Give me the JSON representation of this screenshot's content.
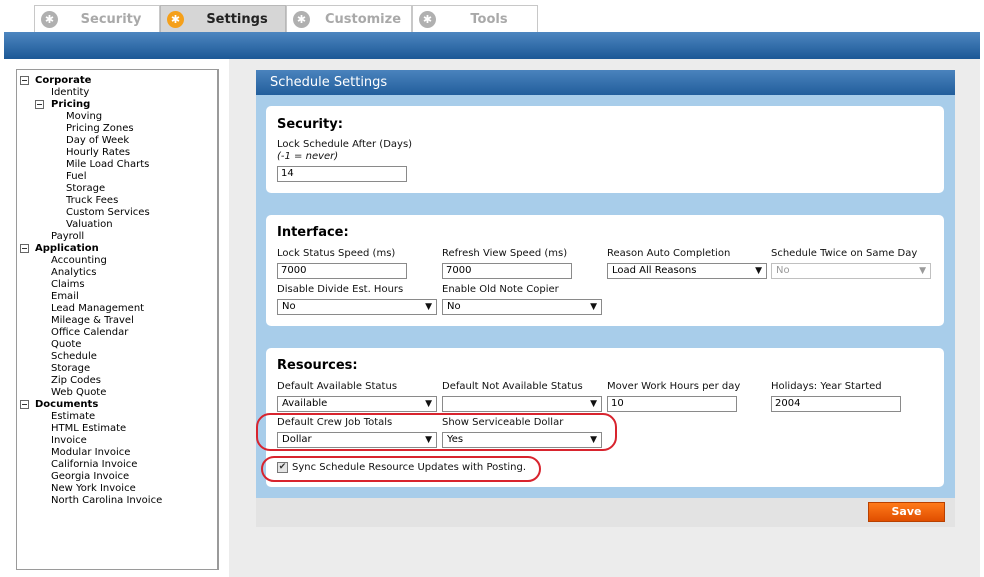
{
  "tabs": [
    {
      "label": "Security",
      "icon": "asterisk-icon"
    },
    {
      "label": "Settings",
      "icon": "asterisk-icon",
      "active": true
    },
    {
      "label": "Customize",
      "icon": "asterisk-icon"
    },
    {
      "label": "Tools",
      "icon": "asterisk-icon"
    }
  ],
  "tree": {
    "corporate": "Corporate",
    "identity": "Identity",
    "pricing": "Pricing",
    "pricing_items": [
      "Moving",
      "Pricing Zones",
      "Day of Week",
      "Hourly Rates",
      "Mile Load Charts",
      "Fuel",
      "Storage",
      "Truck Fees",
      "Custom Services",
      "Valuation"
    ],
    "payroll": "Payroll",
    "application": "Application",
    "application_items": [
      "Accounting",
      "Analytics",
      "Claims",
      "Email",
      "Lead Management",
      "Mileage & Travel",
      "Office Calendar",
      "Quote",
      "Schedule",
      "Storage",
      "Zip Codes",
      "Web Quote"
    ],
    "documents": "Documents",
    "documents_items": [
      "Estimate",
      "HTML Estimate",
      "Invoice",
      "Modular Invoice",
      "California Invoice",
      "Georgia Invoice",
      "New York Invoice",
      "North Carolina Invoice"
    ]
  },
  "schedule": {
    "title": "Schedule Settings",
    "security": {
      "heading": "Security:",
      "lock_label": "Lock Schedule After (Days)",
      "lock_hint": "(-1 = never)",
      "lock_value": "14"
    },
    "interface": {
      "heading": "Interface:",
      "lock_status_label": "Lock Status Speed (ms)",
      "lock_status_value": "7000",
      "refresh_label": "Refresh View Speed (ms)",
      "refresh_value": "7000",
      "reason_label": "Reason Auto Completion",
      "reason_value": "Load All Reasons",
      "twice_label": "Schedule Twice on Same Day",
      "twice_value": "No",
      "divide_label": "Disable Divide Est. Hours",
      "divide_value": "No",
      "copier_label": "Enable Old Note Copier",
      "copier_value": "No"
    },
    "resources": {
      "heading": "Resources:",
      "avail_label": "Default Available Status",
      "avail_value": "Available",
      "not_avail_label": "Default Not Available Status",
      "not_avail_value": "",
      "mover_label": "Mover Work Hours per day",
      "mover_value": "10",
      "holidays_label": "Holidays: Year Started",
      "holidays_value": "2004",
      "crew_label": "Default Crew Job Totals",
      "crew_value": "Dollar",
      "serviceable_label": "Show Serviceable Dollar",
      "serviceable_value": "Yes",
      "sync_label": "Sync Schedule Resource Updates with Posting.",
      "sync_checked": true
    },
    "save_label": "Save"
  },
  "colors": {
    "accent_blue": "#1c5896",
    "panel_blue": "#a8cdea",
    "save_orange": "#f06010",
    "highlight_red": "#d8242e",
    "active_tab_icon": "#f5a01a"
  }
}
